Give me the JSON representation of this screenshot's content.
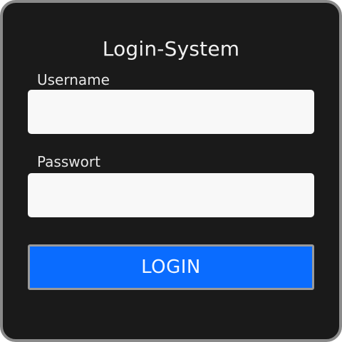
{
  "window": {
    "title": "Login-System"
  },
  "form": {
    "username_label": "Username",
    "username_value": "",
    "password_label": "Passwort",
    "password_value": "",
    "login_label": "LOGIN"
  },
  "colors": {
    "background": "#1a1a1a",
    "frame": "#8a8a8a",
    "input_background": "#f8f8f8",
    "accent": "#0a6cff"
  }
}
